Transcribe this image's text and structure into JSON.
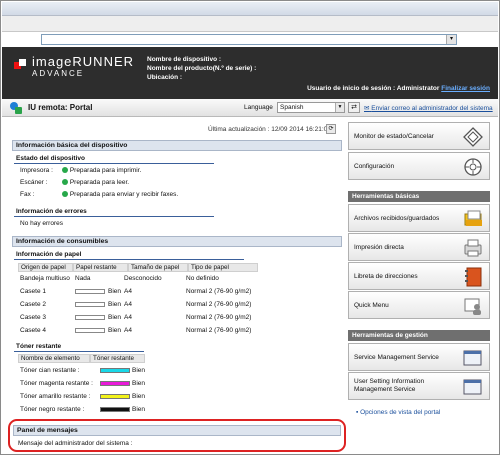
{
  "address_bar": {
    "value": ""
  },
  "header": {
    "brand_line1": "imageRUNNER",
    "brand_line2": "ADVANCE",
    "device_name_label": "Nombre de dispositivo :",
    "product_name_label": "Nombre del producto(N.º de serie) :",
    "location_label": "Ubicación :",
    "login_label": "Usuario de inicio de sesión : Administrator",
    "logout_link": "Finalizar sesión"
  },
  "navbar": {
    "title": "IU remota: Portal",
    "language_label": "Language",
    "language_value": "Spanish",
    "mail_link": "Enviar correo al administrador del sistema"
  },
  "main": {
    "last_update": "Última actualización : 12/09 2014 16:21:06",
    "basic_info_title": "Información básica del dispositivo",
    "device_status_title": "Estado del dispositivo",
    "device_status": [
      {
        "label": "Impresora :",
        "status": "Preparada para imprimir."
      },
      {
        "label": "Escáner :",
        "status": "Preparada para leer."
      },
      {
        "label": "Fax :",
        "status": "Preparada para enviar y recibir faxes."
      }
    ],
    "errors_title": "Información de errores",
    "errors_value": "No hay errores",
    "consumables_title": "Información de consumibles",
    "paper_title": "Información de papel",
    "paper_headers": [
      "Origen de papel",
      "Papel restante",
      "Tamaño de papel",
      "Tipo de papel"
    ],
    "paper_rows": [
      {
        "source": "Bandeja multiuso",
        "remaining": "Nada",
        "size": "Desconocido",
        "type": "No definido",
        "bar": false
      },
      {
        "source": "Casete 1",
        "remaining": "Bien",
        "size": "A4",
        "type": "Normal 2 (76-90 g/m2)",
        "bar": true
      },
      {
        "source": "Casete 2",
        "remaining": "Bien",
        "size": "A4",
        "type": "Normal 2 (76-90 g/m2)",
        "bar": true
      },
      {
        "source": "Casete 3",
        "remaining": "Bien",
        "size": "A4",
        "type": "Normal 2 (76-90 g/m2)",
        "bar": true
      },
      {
        "source": "Casete 4",
        "remaining": "Bien",
        "size": "A4",
        "type": "Normal 2 (76-90 g/m2)",
        "bar": true
      }
    ],
    "toner_title": "Tóner restante",
    "toner_headers": [
      "Nombre de elemento",
      "Tóner restante"
    ],
    "toner_rows": [
      {
        "name": "Tóner cian restante :",
        "value": "Bien",
        "color": "#19d8e8"
      },
      {
        "name": "Tóner magenta restante :",
        "value": "Bien",
        "color": "#e81ad8"
      },
      {
        "name": "Tóner amarillo restante :",
        "value": "Bien",
        "color": "#f2f21a"
      },
      {
        "name": "Tóner negro restante :",
        "value": "Bien",
        "color": "#111111"
      }
    ],
    "messages_title": "Panel de mensajes",
    "messages_label": "Mensaje del administrador del sistema :"
  },
  "right": {
    "monitor_label": "Monitor de estado/Cancelar",
    "settings_label": "Configuración",
    "basic_tools_title": "Herramientas básicas",
    "received_files_label": "Archivos recibidos/guardados",
    "direct_print_label": "Impresión directa",
    "address_book_label": "Libreta de direcciones",
    "quick_menu_label": "Quick Menu",
    "mgmt_tools_title": "Herramientas de gestión",
    "service_mgmt_label": "Service Management Service",
    "user_setting_label1": "User Setting Information",
    "user_setting_label2": "Management Service",
    "portal_options_link": "Opciones de vista del portal"
  },
  "colors": {
    "header_bg": "#2d2d2d",
    "status_green": "#27a84a",
    "highlight_red": "#dd2222"
  }
}
